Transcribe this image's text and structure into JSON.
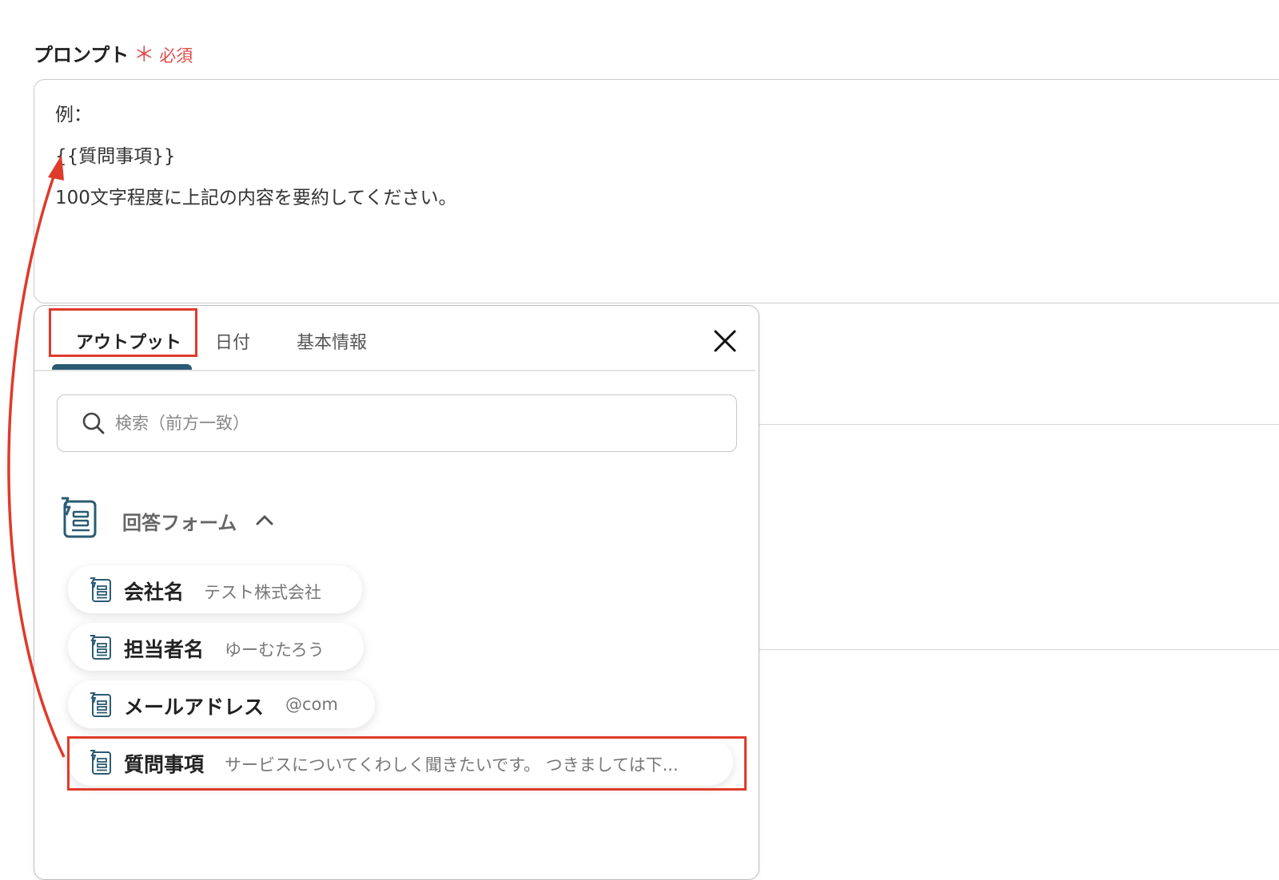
{
  "field": {
    "label": "プロンプト",
    "required_mark": "＊",
    "required_text": "必須",
    "lines": [
      "例：",
      "{{質問事項}}",
      "100文字程度に上記の内容を要約してください。"
    ]
  },
  "picker": {
    "tabs": [
      {
        "label": "アウトプット",
        "active": true
      },
      {
        "label": "日付",
        "active": false
      },
      {
        "label": "基本情報",
        "active": false
      }
    ],
    "search": {
      "placeholder": "検索（前方一致）",
      "value": ""
    },
    "group": {
      "label": "回答フォーム",
      "expanded": true,
      "items": [
        {
          "name": "会社名",
          "value": "テスト株式会社"
        },
        {
          "name": "担当者名",
          "value": "ゆーむたろう"
        },
        {
          "name": "メールアドレス",
          "value": "@com"
        },
        {
          "name": "質問事項",
          "value": "サービスについてくわしく聞きたいです。 つきましては下..."
        }
      ]
    }
  },
  "colors": {
    "required": "#e04b4b",
    "highlight": "#e03a2a",
    "accent": "#2b5b73"
  }
}
